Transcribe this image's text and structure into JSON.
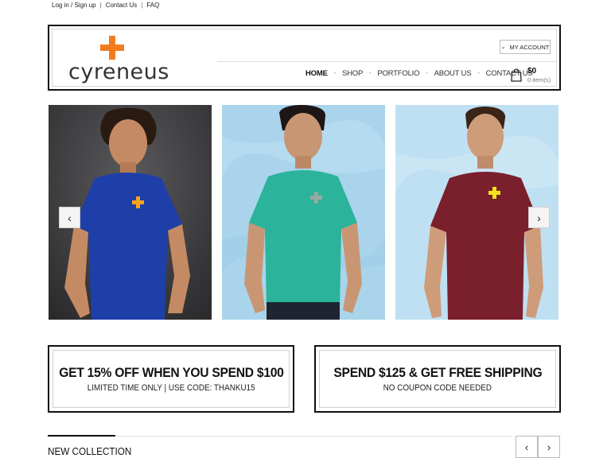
{
  "topbar": {
    "login": "Log in / Sign up",
    "contact": "Contact Us",
    "faq": "FAQ",
    "separator": "|"
  },
  "brand": {
    "name": "cyreneus",
    "accent_color": "#f47c20"
  },
  "account": {
    "label": "MY ACCOUNT",
    "icon": "chevron-down-icon"
  },
  "nav": {
    "items": [
      {
        "label": "HOME",
        "active": true
      },
      {
        "label": "SHOP",
        "active": false
      },
      {
        "label": "PORTFOLIO",
        "active": false
      },
      {
        "label": "ABOUT US",
        "active": false
      },
      {
        "label": "CONTACT US",
        "active": false
      }
    ],
    "separator": "•"
  },
  "cart": {
    "total": "$0",
    "items": "0 item(s)",
    "icon": "shopping-bag-icon"
  },
  "slider": {
    "prev_icon": "chevron-left-icon",
    "next_icon": "chevron-right-icon",
    "slides": [
      {
        "shirt_color": "#1f3fa8",
        "background": "#3a3a3c",
        "logo_color": "#f7a21b"
      },
      {
        "shirt_color": "#2bb39b",
        "background": "#a9d4ec",
        "logo_color": "#9aa6a2"
      },
      {
        "shirt_color": "#7a1f2c",
        "background": "#bfe0f2",
        "logo_color": "#f3e11b"
      }
    ]
  },
  "promos": [
    {
      "title": "GET 15% OFF WHEN YOU SPEND $100",
      "subtitle": "LIMITED TIME ONLY | USE CODE: THANKU15"
    },
    {
      "title": "SPEND $125 & GET FREE SHIPPING",
      "subtitle": "NO COUPON CODE NEEDED"
    }
  ],
  "collection": {
    "title": "NEW COLLECTION",
    "prev_icon": "chevron-left-icon",
    "next_icon": "chevron-right-icon"
  }
}
